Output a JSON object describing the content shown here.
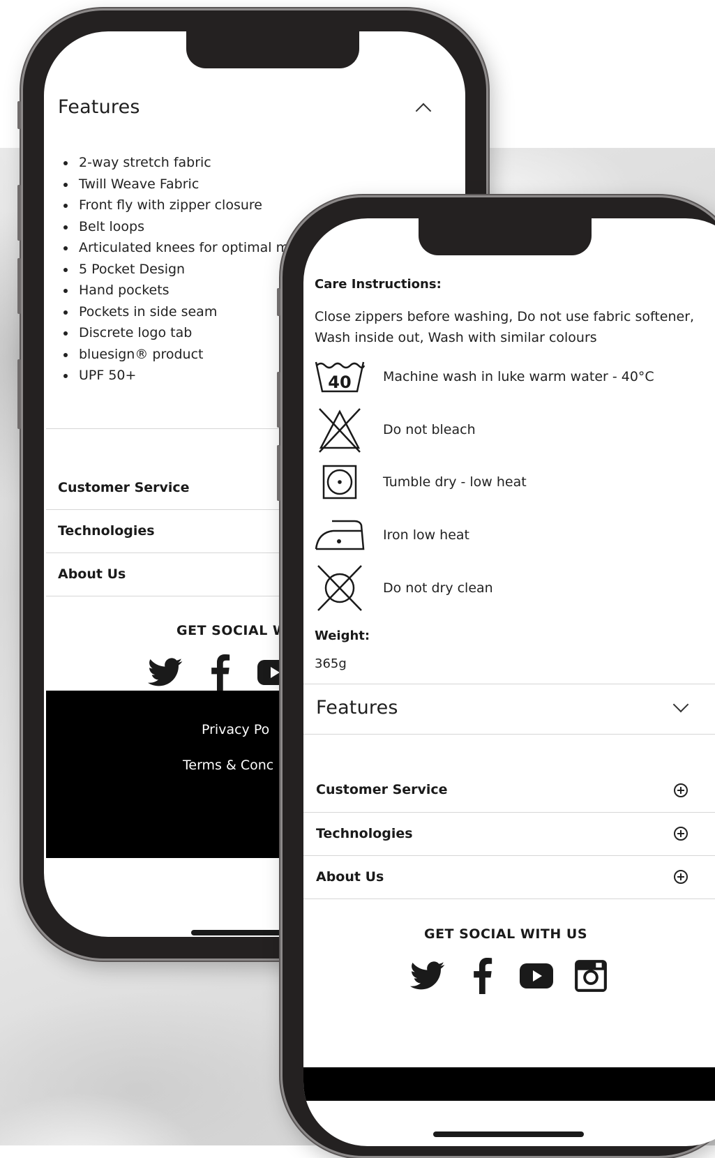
{
  "phone_back": {
    "features": {
      "title": "Features",
      "items": [
        "2-way stretch fabric",
        "Twill Weave Fabric",
        "Front fly with zipper closure",
        "Belt loops",
        "Articulated knees for optimal m",
        "5 Pocket Design",
        "Hand pockets",
        "Pockets in side seam",
        "Discrete logo tab",
        "bluesign® product",
        "UPF 50+"
      ]
    },
    "accordion": [
      "Customer Service",
      "Technologies",
      "About Us"
    ],
    "social_title": "GET SOCIAL W",
    "footer_links": [
      "Privacy Po",
      "Terms & Conc"
    ]
  },
  "phone_front": {
    "care_title": "Care Instructions:",
    "care_text": "Close zippers before washing, Do not use fabric softener, Wash inside out, Wash with similar colours",
    "care_items": [
      {
        "icon": "wash-40-icon",
        "label": "Machine wash in luke warm water - 40°C",
        "badge": "40"
      },
      {
        "icon": "no-bleach-icon",
        "label": "Do not bleach"
      },
      {
        "icon": "tumble-dry-low-icon",
        "label": "Tumble dry - low heat"
      },
      {
        "icon": "iron-low-icon",
        "label": "Iron low heat"
      },
      {
        "icon": "no-dry-clean-icon",
        "label": "Do not dry clean"
      }
    ],
    "weight_title": "Weight:",
    "weight_value": "365g",
    "features_title": "Features",
    "accordion": [
      "Customer Service",
      "Technologies",
      "About Us"
    ],
    "social_title": "GET SOCIAL WITH US"
  },
  "social_icons": [
    "twitter-icon",
    "facebook-icon",
    "youtube-icon",
    "instagram-icon"
  ]
}
